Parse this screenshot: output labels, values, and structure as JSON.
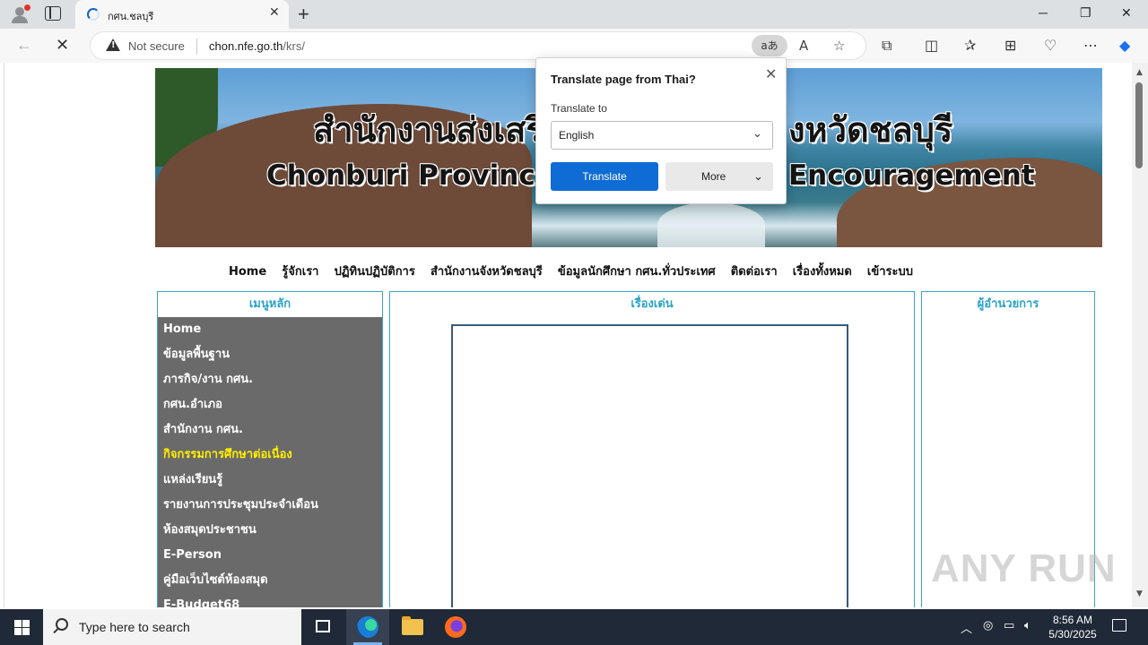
{
  "browser": {
    "tab_title": "กศน.ชลบุรี",
    "security_label": "Not secure",
    "url_domain": "chon.nfe.go.th",
    "url_path": "/krs/",
    "translate_icon_text": "aあ"
  },
  "banner": {
    "thai_title": "สำนักงานส่งเสริม",
    "thai_title_right": "งหวัดชลบุรี",
    "english_left": "Chonburi Provincial",
    "english_right": "Encouragement"
  },
  "top_menu": [
    "Home",
    "รู้จักเรา",
    "ปฏิทินปฏิบัติการ",
    "สำนักงานจังหวัดชลบุรี",
    "ข้อมูลนักศึกษา กศน.ทั่วประเทศ",
    "ติดต่อเรา",
    "เรื่องทั้งหมด",
    "เข้าระบบ"
  ],
  "left_panel": {
    "title": "เมนูหลัก",
    "items": [
      {
        "label": "Home"
      },
      {
        "label": "ข้อมูลพื้นฐาน"
      },
      {
        "label": "ภารกิจ/งาน กศน."
      },
      {
        "label": "กศน.อำเภอ"
      },
      {
        "label": "สำนักงาน กศน."
      },
      {
        "label": "กิจกรรมการศึกษาต่อเนื่อง"
      },
      {
        "label": "แหล่งเรียนรู้"
      },
      {
        "label": "รายงานการประชุมประจำเดือน"
      },
      {
        "label": "ห้องสมุดประชาชน"
      },
      {
        "label": "E-Person"
      },
      {
        "label": "คู่มือเว็บไซต์ห้องสมุด"
      },
      {
        "label": "E-Budget68"
      }
    ]
  },
  "mid_panel": {
    "title": "เรื่องเด่น"
  },
  "right_panel": {
    "title": "ผู้อำนวยการ"
  },
  "translate_popup": {
    "title": "Translate page from Thai?",
    "label": "Translate to",
    "selected_language": "English",
    "translate_button": "Translate",
    "more_button": "More"
  },
  "watermark": "ANY RUN",
  "taskbar": {
    "search_placeholder": "Type here to search",
    "time": "8:56 AM",
    "date": "5/30/2025"
  },
  "colors": {
    "panel_border": "#3aa6c0",
    "panel_title": "#2aa3c8",
    "menu_bg": "#6a6a6a",
    "menu_active": "#ffef00",
    "translate_btn": "#0f6cd4"
  }
}
